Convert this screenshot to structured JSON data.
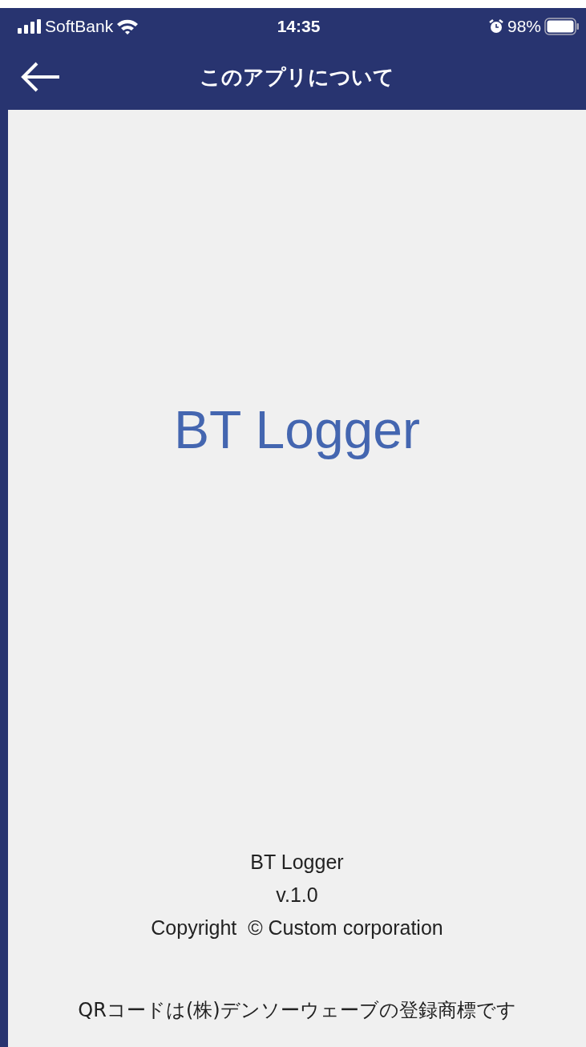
{
  "status_bar": {
    "carrier": "SoftBank",
    "time": "14:35",
    "battery": "98%"
  },
  "nav_bar": {
    "title": "このアプリについて"
  },
  "app_name": "BT Logger",
  "footer": {
    "lines": [
      "BT Logger",
      "v.1.0",
      "Copyright  © Custom corporation"
    ],
    "notice": "QRコードは(株)デンソーウェーブの登録商標です"
  }
}
